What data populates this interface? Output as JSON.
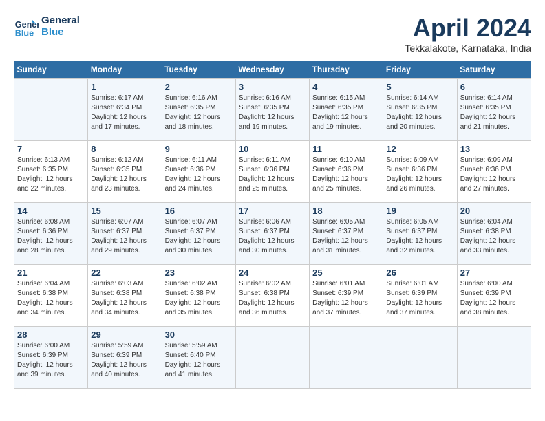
{
  "header": {
    "logo_line1": "General",
    "logo_line2": "Blue",
    "month_title": "April 2024",
    "location": "Tekkalakote, Karnataka, India"
  },
  "days_of_week": [
    "Sunday",
    "Monday",
    "Tuesday",
    "Wednesday",
    "Thursday",
    "Friday",
    "Saturday"
  ],
  "weeks": [
    [
      {
        "day": "",
        "info": ""
      },
      {
        "day": "1",
        "info": "Sunrise: 6:17 AM\nSunset: 6:34 PM\nDaylight: 12 hours\nand 17 minutes."
      },
      {
        "day": "2",
        "info": "Sunrise: 6:16 AM\nSunset: 6:35 PM\nDaylight: 12 hours\nand 18 minutes."
      },
      {
        "day": "3",
        "info": "Sunrise: 6:16 AM\nSunset: 6:35 PM\nDaylight: 12 hours\nand 19 minutes."
      },
      {
        "day": "4",
        "info": "Sunrise: 6:15 AM\nSunset: 6:35 PM\nDaylight: 12 hours\nand 19 minutes."
      },
      {
        "day": "5",
        "info": "Sunrise: 6:14 AM\nSunset: 6:35 PM\nDaylight: 12 hours\nand 20 minutes."
      },
      {
        "day": "6",
        "info": "Sunrise: 6:14 AM\nSunset: 6:35 PM\nDaylight: 12 hours\nand 21 minutes."
      }
    ],
    [
      {
        "day": "7",
        "info": "Sunrise: 6:13 AM\nSunset: 6:35 PM\nDaylight: 12 hours\nand 22 minutes."
      },
      {
        "day": "8",
        "info": "Sunrise: 6:12 AM\nSunset: 6:35 PM\nDaylight: 12 hours\nand 23 minutes."
      },
      {
        "day": "9",
        "info": "Sunrise: 6:11 AM\nSunset: 6:36 PM\nDaylight: 12 hours\nand 24 minutes."
      },
      {
        "day": "10",
        "info": "Sunrise: 6:11 AM\nSunset: 6:36 PM\nDaylight: 12 hours\nand 25 minutes."
      },
      {
        "day": "11",
        "info": "Sunrise: 6:10 AM\nSunset: 6:36 PM\nDaylight: 12 hours\nand 25 minutes."
      },
      {
        "day": "12",
        "info": "Sunrise: 6:09 AM\nSunset: 6:36 PM\nDaylight: 12 hours\nand 26 minutes."
      },
      {
        "day": "13",
        "info": "Sunrise: 6:09 AM\nSunset: 6:36 PM\nDaylight: 12 hours\nand 27 minutes."
      }
    ],
    [
      {
        "day": "14",
        "info": "Sunrise: 6:08 AM\nSunset: 6:36 PM\nDaylight: 12 hours\nand 28 minutes."
      },
      {
        "day": "15",
        "info": "Sunrise: 6:07 AM\nSunset: 6:37 PM\nDaylight: 12 hours\nand 29 minutes."
      },
      {
        "day": "16",
        "info": "Sunrise: 6:07 AM\nSunset: 6:37 PM\nDaylight: 12 hours\nand 30 minutes."
      },
      {
        "day": "17",
        "info": "Sunrise: 6:06 AM\nSunset: 6:37 PM\nDaylight: 12 hours\nand 30 minutes."
      },
      {
        "day": "18",
        "info": "Sunrise: 6:05 AM\nSunset: 6:37 PM\nDaylight: 12 hours\nand 31 minutes."
      },
      {
        "day": "19",
        "info": "Sunrise: 6:05 AM\nSunset: 6:37 PM\nDaylight: 12 hours\nand 32 minutes."
      },
      {
        "day": "20",
        "info": "Sunrise: 6:04 AM\nSunset: 6:38 PM\nDaylight: 12 hours\nand 33 minutes."
      }
    ],
    [
      {
        "day": "21",
        "info": "Sunrise: 6:04 AM\nSunset: 6:38 PM\nDaylight: 12 hours\nand 34 minutes."
      },
      {
        "day": "22",
        "info": "Sunrise: 6:03 AM\nSunset: 6:38 PM\nDaylight: 12 hours\nand 34 minutes."
      },
      {
        "day": "23",
        "info": "Sunrise: 6:02 AM\nSunset: 6:38 PM\nDaylight: 12 hours\nand 35 minutes."
      },
      {
        "day": "24",
        "info": "Sunrise: 6:02 AM\nSunset: 6:38 PM\nDaylight: 12 hours\nand 36 minutes."
      },
      {
        "day": "25",
        "info": "Sunrise: 6:01 AM\nSunset: 6:39 PM\nDaylight: 12 hours\nand 37 minutes."
      },
      {
        "day": "26",
        "info": "Sunrise: 6:01 AM\nSunset: 6:39 PM\nDaylight: 12 hours\nand 37 minutes."
      },
      {
        "day": "27",
        "info": "Sunrise: 6:00 AM\nSunset: 6:39 PM\nDaylight: 12 hours\nand 38 minutes."
      }
    ],
    [
      {
        "day": "28",
        "info": "Sunrise: 6:00 AM\nSunset: 6:39 PM\nDaylight: 12 hours\nand 39 minutes."
      },
      {
        "day": "29",
        "info": "Sunrise: 5:59 AM\nSunset: 6:39 PM\nDaylight: 12 hours\nand 40 minutes."
      },
      {
        "day": "30",
        "info": "Sunrise: 5:59 AM\nSunset: 6:40 PM\nDaylight: 12 hours\nand 41 minutes."
      },
      {
        "day": "",
        "info": ""
      },
      {
        "day": "",
        "info": ""
      },
      {
        "day": "",
        "info": ""
      },
      {
        "day": "",
        "info": ""
      }
    ]
  ]
}
